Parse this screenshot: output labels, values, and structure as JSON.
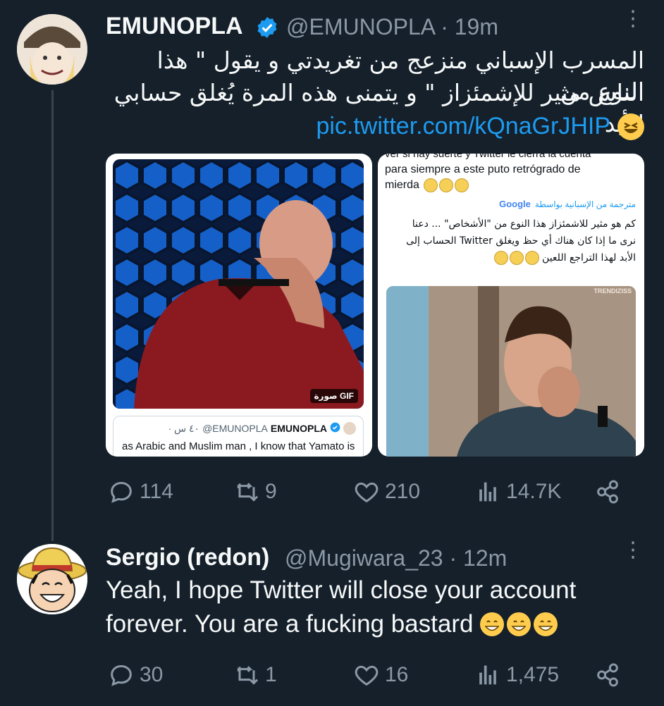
{
  "tweet1": {
    "name": "EMUNOPLA",
    "handle": "@EMUNOPLA",
    "time": "· 19m",
    "text_line1": "المسرب الإسباني منزعج من تغريدتي و يقول \" هذا النوع من",
    "text_line2": "الناس مثير للإشمئزاز \" و يتمنى هذه المرة يُغلق حسابي للأبد",
    "link": "pic.twitter.com/kQnaGrJHIP",
    "media": {
      "gif_badge": "صورة GIF",
      "quoted_name": "EMUNOPLA",
      "quoted_handle": "@EMUNOPLA",
      "quoted_time": "· ٤٠ س",
      "quoted_text": "as Arabic and Muslim man , I know that Yamato is",
      "right_top_cut": "ver si hay suerte y Twitter le cierra la cuenta",
      "right_es_line1": "para siempre a este puto retrógrado de",
      "right_es_line2": "mierda",
      "translated_by": "مترجمة من الإسبانية بواسطة",
      "google": "Google",
      "right_ar_line1": "كم هو مثير للاشمئزاز هذا النوع من \"الأشخاص\" ... دعنا",
      "right_ar_line2": "نرى ما إذا كان هناك أي حظ ويغلق Twitter الحساب إلى",
      "right_ar_line3": "الأبد لهذا التراجع اللعين",
      "watermark": "TRENDIZISS"
    },
    "actions": {
      "replies": "114",
      "retweets": "9",
      "likes": "210",
      "views": "14.7K"
    }
  },
  "tweet2": {
    "name": "Sergio (redon)",
    "handle": "@Mugiwara_23",
    "time": "· 12m",
    "text_line1": "Yeah, I hope Twitter will close your account",
    "text_line2": "forever. You are a fucking bastard",
    "actions": {
      "replies": "30",
      "retweets": "1",
      "likes": "16",
      "views": "1,475"
    }
  },
  "colors": {
    "background": "#15202b",
    "accent": "#1d9bf0",
    "muted": "#8b98a5",
    "verified": "#1d9bf0"
  }
}
